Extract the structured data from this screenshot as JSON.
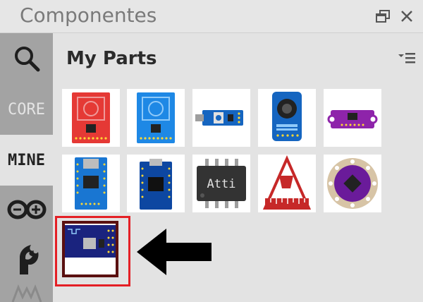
{
  "window": {
    "title": "Componentes",
    "title_color": "#7a7a7a",
    "float_icon": "undock-icon",
    "close_icon": "close-icon"
  },
  "sidebar": {
    "tabs": [
      {
        "id": "search",
        "label": "",
        "icon": "search-icon",
        "active": false
      },
      {
        "id": "core",
        "label": "CORE",
        "active": false
      },
      {
        "id": "mine",
        "label": "MINE",
        "active": true
      },
      {
        "id": "arduino",
        "label": "",
        "icon": "arduino-icon",
        "active": false
      },
      {
        "id": "sparkfun",
        "label": "",
        "icon": "sparkfun-flame-icon",
        "active": false
      },
      {
        "id": "more",
        "label": "",
        "icon": "more-bins-icon",
        "active": false
      }
    ]
  },
  "bin": {
    "title": "My Parts",
    "menu_icon": "bin-menu-icon",
    "parts": [
      {
        "name": "rfid-reader-red",
        "color": "#e53935"
      },
      {
        "name": "rfid-reader-blue",
        "color": "#1e88e5"
      },
      {
        "name": "sensor-module",
        "color": "#1565c0"
      },
      {
        "name": "sound-sensor",
        "color": "#1565c0"
      },
      {
        "name": "purple-breakout",
        "color": "#8e24aa"
      },
      {
        "name": "usb-serial-board",
        "color": "#1976d2"
      },
      {
        "name": "mini-usb-board",
        "color": "#0d47a1"
      },
      {
        "name": "attiny-chip",
        "color": "#333333",
        "label": "Atti"
      },
      {
        "name": "ruler-icon-part",
        "color": "#c62828"
      },
      {
        "name": "lilypad-board",
        "color": "#6a1b9a"
      },
      {
        "name": "esp8266-module",
        "color": "#1a237e",
        "selected": true
      }
    ]
  },
  "annotations": {
    "highlight_color": "#e41f25",
    "arrow_color": "#000000"
  }
}
